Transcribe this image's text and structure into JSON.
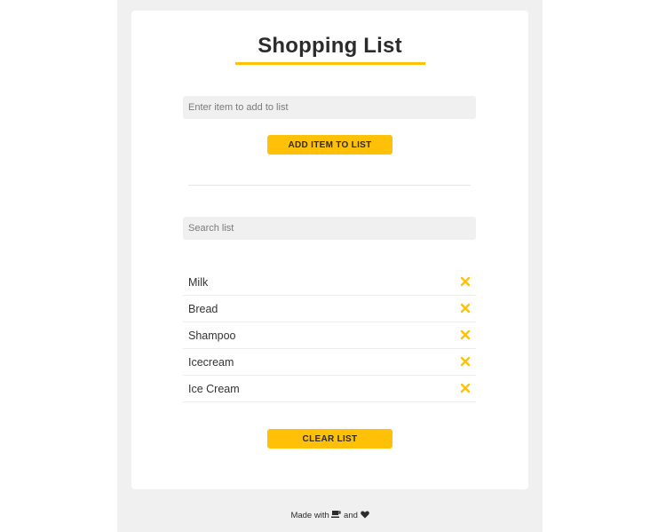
{
  "header": {
    "title": "Shopping List"
  },
  "add_form": {
    "placeholder": "Enter item to add to list",
    "value": "",
    "button_label": "ADD ITEM TO LIST"
  },
  "search": {
    "placeholder": "Search list",
    "value": ""
  },
  "items": [
    {
      "label": "Milk",
      "remove_icon": "close-icon"
    },
    {
      "label": "Bread",
      "remove_icon": "close-icon"
    },
    {
      "label": "Shampoo",
      "remove_icon": "close-icon"
    },
    {
      "label": "Icecream",
      "remove_icon": "close-icon"
    },
    {
      "label": "Ice Cream",
      "remove_icon": "close-icon"
    }
  ],
  "clear_button_label": "CLEAR LIST",
  "footer": {
    "made_with": "Made with",
    "and": "and",
    "icon_1": "coffee-icon",
    "icon_2": "heart-icon"
  },
  "colors": {
    "accent": "#ffc107",
    "background": "#f0f0f0",
    "card": "#ffffff",
    "text": "#2b2b2b"
  }
}
